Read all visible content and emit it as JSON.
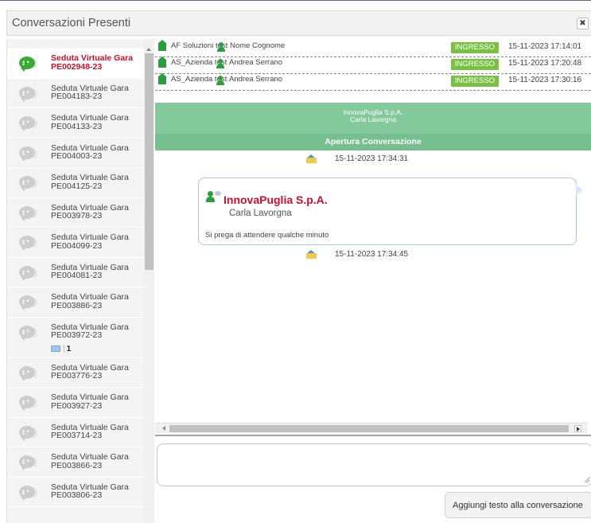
{
  "window": {
    "title": "Conversazioni Presenti",
    "close_label": "✖"
  },
  "conversations": [
    {
      "line1": "Seduta Virtuale Gara",
      "line2": "PE002948-23",
      "active": true
    },
    {
      "line1": "Seduta Virtuale Gara",
      "line2": "PE004183-23"
    },
    {
      "line1": "Seduta Virtuale Gara",
      "line2": "PE004133-23"
    },
    {
      "line1": "Seduta Virtuale Gara",
      "line2": "PE004003-23"
    },
    {
      "line1": "Seduta Virtuale Gara",
      "line2": "PE004125-23"
    },
    {
      "line1": "Seduta Virtuale Gara",
      "line2": "PE003978-23"
    },
    {
      "line1": "Seduta Virtuale Gara",
      "line2": "PE004099-23"
    },
    {
      "line1": "Seduta Virtuale Gara",
      "line2": "PE004081-23"
    },
    {
      "line1": "Seduta Virtuale Gara",
      "line2": "PE003886-23"
    },
    {
      "line1": "Seduta Virtuale Gara",
      "line2": "PE003972-23",
      "unread": "1"
    },
    {
      "line1": "Seduta Virtuale Gara",
      "line2": "PE003776-23"
    },
    {
      "line1": "Seduta Virtuale Gara",
      "line2": "PE003927-23"
    },
    {
      "line1": "Seduta Virtuale Gara",
      "line2": "PE003714-23"
    },
    {
      "line1": "Seduta Virtuale Gara",
      "line2": "PE003866-23"
    },
    {
      "line1": "Seduta Virtuale Gara",
      "line2": "PE003806-23"
    }
  ],
  "participants": [
    {
      "company": "AF Soluzioni test",
      "person": "Nome Cognome",
      "status": "INGRESSO",
      "time": "15-11-2023 17:14:01"
    },
    {
      "company": "AS_Azienda test",
      "person": "Andrea Serrano",
      "status": "INGRESSO",
      "time": "15-11-2023 17:20:48"
    },
    {
      "company": "AS_Azienda test",
      "person": "Andrea Serrano",
      "status": "INGRESSO",
      "time": "15-11-2023 17:30:16"
    }
  ],
  "opening": {
    "org": "InnovaPuglia S.p.A.",
    "person": "Carla Lavorgna",
    "title": "Apertura Conversazione",
    "time": "15-11-2023 17:34:31"
  },
  "message": {
    "sender_org": "InnovaPuglia S.p.A.",
    "sender_person": "Carla Lavorgna",
    "text": "Si prega di attendere qualche minuto",
    "time": "15-11-2023 17:34:45"
  },
  "compose": {
    "placeholder": "",
    "add_button_label": "Aggiungi testo alla conversazione"
  },
  "colors": {
    "accent_green": "#7ac143",
    "banner_green": "#84c99b",
    "active_red": "#c8102e"
  }
}
